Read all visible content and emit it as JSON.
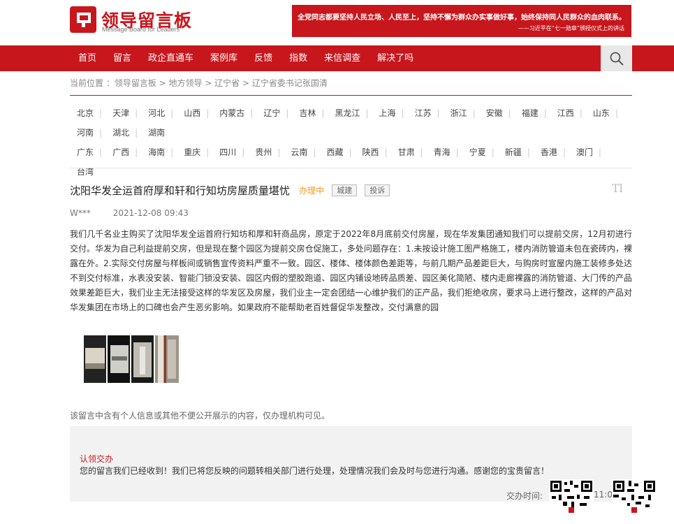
{
  "header": {
    "logo_title": "领导留言板",
    "logo_subtitle": "Message Board for Leaders",
    "banner_text": "全党同志都要坚持人民立场、人民至上，坚持不懈为群众办实事做好事，始终保持同人民群众的血肉联系。",
    "banner_quote": "——习近平在“七一勋章”颁授仪式上的讲话"
  },
  "nav": {
    "items": [
      "首页",
      "留言",
      "政企直通车",
      "案例库",
      "反馈",
      "指数",
      "来信调查",
      "解决了吗"
    ],
    "search_icon": "search-icon"
  },
  "breadcrumb": "当前位置 ：领导留言板 > 地方领导 > 辽宁省 > 辽宁省委书记张国清",
  "regions": [
    "北京",
    "天津",
    "河北",
    "山西",
    "内蒙古",
    "辽宁",
    "吉林",
    "黑龙江",
    "上海",
    "江苏",
    "浙江",
    "安徽",
    "福建",
    "江西",
    "山东",
    "河南",
    "湖北",
    "湖南",
    "广东",
    "广西",
    "海南",
    "重庆",
    "四川",
    "贵州",
    "云南",
    "西藏",
    "陕西",
    "甘肃",
    "青海",
    "宁夏",
    "新疆",
    "香港",
    "澳门",
    "台湾"
  ],
  "post": {
    "title": "沈阳华发全运首府厚和轩和行知坊房屋质量堪忧",
    "status": "办理中",
    "tags": [
      "城建",
      "投诉"
    ],
    "font_toggle": "Tl",
    "author": "W***",
    "date": "2021-12-08 09:43",
    "body": "我们几千名业主购买了沈阳华发全运首府行知坊和厚和轩商品房，原定于2022年8月底前交付房屋，现在华发集团通知我们可以提前交房，12月初进行交付。华发为自己利益提前交房，但是现在整个园区为提前交房仓促施工，多处问题存在：1.未按设计施工图严格施工，楼内消防管道未包在瓷砖内，裸露在外。2.实际交付房屋与样板间或销售宣传资料严重不一致。园区、楼体、楼体颜色差距等，与前几期产品差距巨大，与购房时宣屋内施工装修多处达不到交付标准，水表没安装、智能门锁没安装、园区内假的塑胶跑道、园区内铺设地砖品质差、园区美化简陋、楼内走廊裸露的消防管道、大门传的产品效果差距巨大，我们业主无法接受这样的华发区及房屋，我们业主一定会团结一心维护我们的正产品，我们拒绝收房，要求马上进行整改，这样的产品对华发集团在市场上的口碑也会产生恶劣影响。如果政府不能帮助老百姓督促华发整改，交付满意的园",
    "privacy_note": "该留言中含有个人信息或其他不便公开展示的内容，仅办理机构可见。"
  },
  "reply": {
    "title": "认领交办",
    "body": "您的留言我们已经收到！我们已将您反映的问题转相关部门进行处理，处理情况我们会及时与您进行沟通。感谢您的宝贵留言！",
    "time_label": "交办时间:",
    "time_value": "11:0"
  },
  "colors": {
    "brand_red": "#c8161d",
    "status_orange": "#f39a1f"
  }
}
